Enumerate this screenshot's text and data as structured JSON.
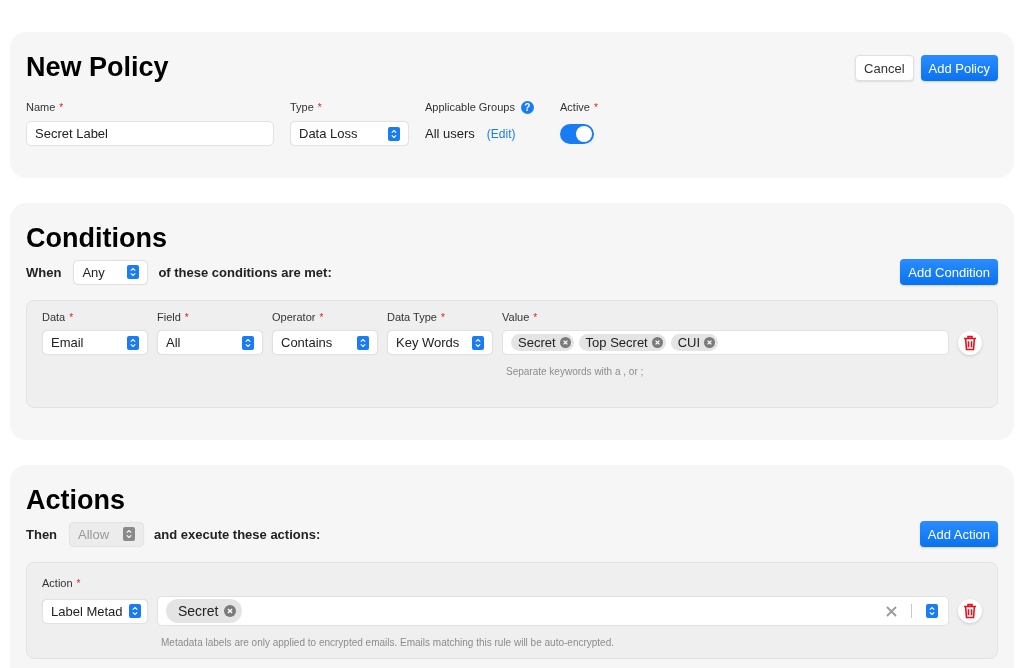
{
  "policy": {
    "title": "New Policy",
    "buttons": [
      {
        "label": "Cancel",
        "kind": "secondary"
      },
      {
        "label": "Add Policy",
        "kind": "primary"
      }
    ],
    "name": {
      "label": "Name",
      "required_mark": "*",
      "value": "Secret Label"
    },
    "type": {
      "label": "Type",
      "required_mark": "*",
      "value": "Data Loss"
    },
    "groups": {
      "label": "Applicable Groups",
      "help": "?",
      "value": "All users",
      "link": "(Edit)"
    },
    "active": {
      "label": "Active",
      "required_mark": "*",
      "on": true
    }
  },
  "sections": [
    {
      "title": "Conditions",
      "lead": "When",
      "match": {
        "value": "Any",
        "disabled": false
      },
      "trail": "of these conditions are met:",
      "add_button": "Add Condition",
      "rows": [
        {
          "fields": [
            {
              "kind": "select",
              "label": "Data",
              "required_mark": "*",
              "value": "Email"
            },
            {
              "kind": "select",
              "label": "Field",
              "required_mark": "*",
              "value": "All"
            },
            {
              "kind": "select",
              "label": "Operator",
              "required_mark": "*",
              "value": "Contains"
            },
            {
              "kind": "select",
              "label": "Data Type",
              "required_mark": "*",
              "value": "Key Words"
            },
            {
              "kind": "tags",
              "label": "Value",
              "required_mark": "*",
              "tags": [
                "Secret",
                "Top Secret",
                "CUI"
              ]
            }
          ],
          "hint": "Separate keywords with a , or ;"
        }
      ]
    },
    {
      "title": "Actions",
      "lead": "Then",
      "match": {
        "value": "Allow",
        "disabled": true
      },
      "trail": "and execute these actions:",
      "add_button": "Add Action",
      "rows": [
        {
          "fields": [
            {
              "kind": "select",
              "label": "Action",
              "required_mark": "*",
              "value": "Label Metad"
            },
            {
              "kind": "tagselect",
              "tags": [
                "Secret"
              ]
            }
          ],
          "hint": "Metadata labels are only applied to encrypted emails. Emails matching this rule will be auto-encrypted."
        }
      ]
    }
  ]
}
